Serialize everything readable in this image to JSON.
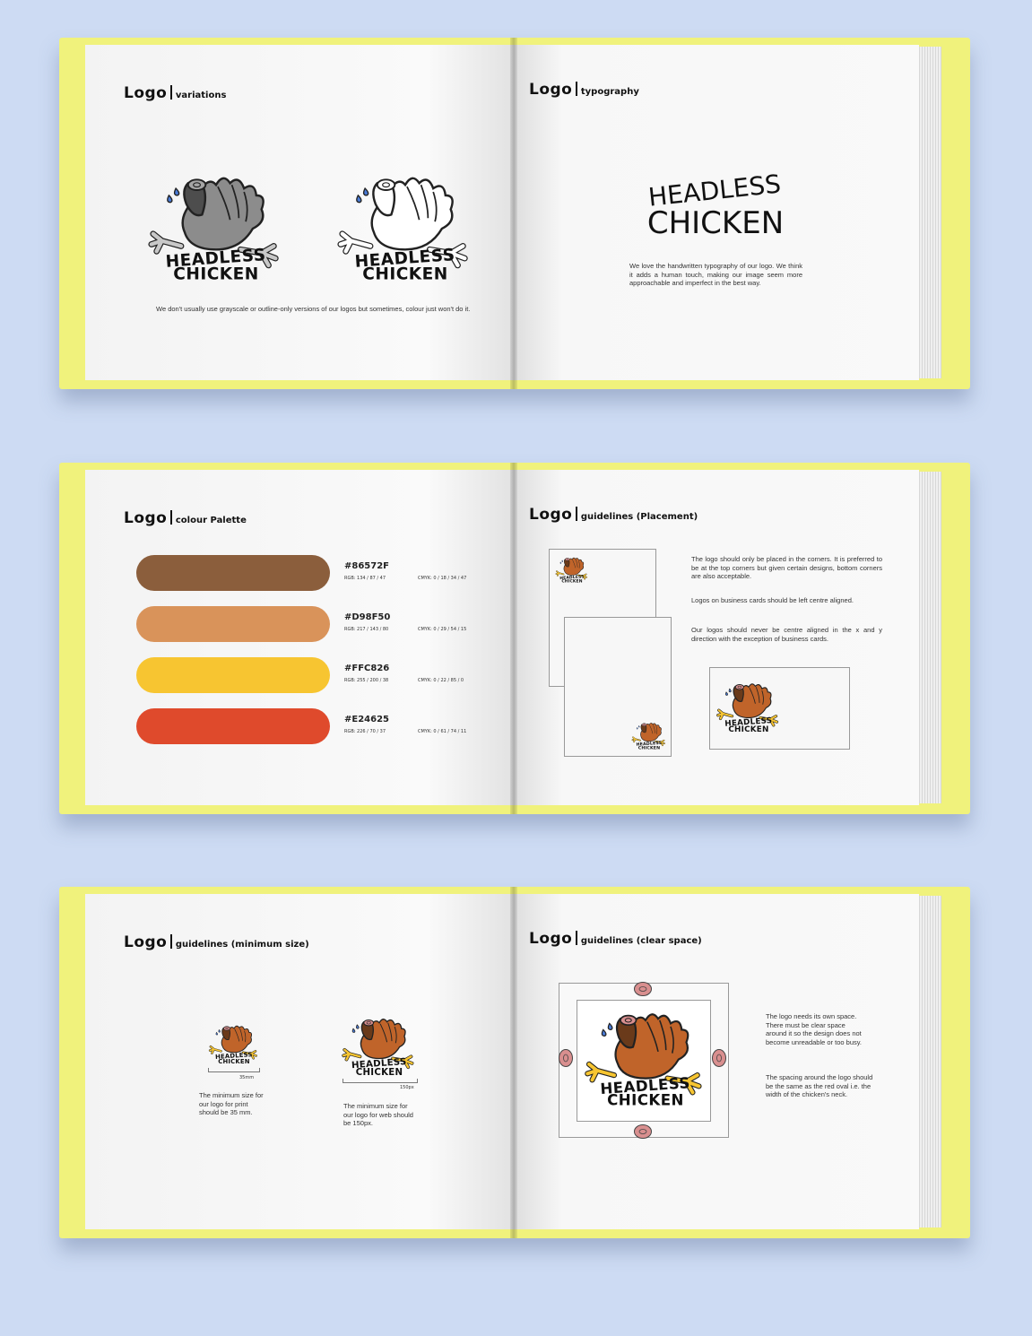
{
  "logo_word": "Logo",
  "spread1": {
    "left": {
      "subtitle": "variations",
      "logo_text_line1": "HEADLESS",
      "logo_text_line2": "CHICKEN",
      "body": "We don't usually use grayscale or outline-only versions of our logos but sometimes, colour just won't do it."
    },
    "right": {
      "subtitle": "typography",
      "wordmark_line1": "HEADLESS",
      "wordmark_line2": "CHICKEN",
      "body": "We love the handwritten typography of our logo. We think it adds a human touch, making our image seem more approachable and imperfect in the best way."
    }
  },
  "spread2": {
    "left": {
      "subtitle": "colour Palette",
      "colors": [
        {
          "hex": "#86572F",
          "swatch": "#8b5e3c",
          "rgb": "RGB: 134 / 87 / 47",
          "cmyk": "CMYK: 0 / 18 / 34 / 47"
        },
        {
          "hex": "#D98F50",
          "swatch": "#d9935a",
          "rgb": "RGB: 217 / 143 / 80",
          "cmyk": "CMYK: 0 / 29 / 54 / 15"
        },
        {
          "hex": "#FFC826",
          "swatch": "#f7c531",
          "rgb": "RGB: 255 / 200 / 38",
          "cmyk": "CMYK: 0 / 22 / 85 / 0"
        },
        {
          "hex": "#E24625",
          "swatch": "#df4a2c",
          "rgb": "RGB: 226 / 70 / 37",
          "cmyk": "CMYK: 0 / 61 / 74 / 11"
        }
      ]
    },
    "right": {
      "subtitle": "guidelines (Placement)",
      "para1": "The logo should only be placed in the corners. It is preferred to be at the top corners but given certain designs, bottom corners are also acceptable.",
      "para2": "Logos on business cards should be left centre aligned.",
      "para3": "Our logos should never be centre aligned in the x and y direction with the exception of business cards."
    }
  },
  "spread3": {
    "left": {
      "subtitle": "guidelines (minimum size)",
      "print_measure": "35mm",
      "web_measure": "150px",
      "print_text": "The minimum size for our logo for print should be 35 mm.",
      "web_text": "The minimum size for our logo for web should be 150px."
    },
    "right": {
      "subtitle": "guidelines (clear space)",
      "para1": "The logo needs its own space. There must be clear space around it so the design does not become unreadable or too busy.",
      "para2": "The spacing around the logo should be the same as the red oval i.e. the width of the chicken's neck."
    }
  },
  "colors": {
    "background": "#cddbf3",
    "cover": "#f0f27c",
    "chicken_body": "#c0642a",
    "chicken_feet": "#f7c531",
    "neck": "#d98f8f"
  }
}
